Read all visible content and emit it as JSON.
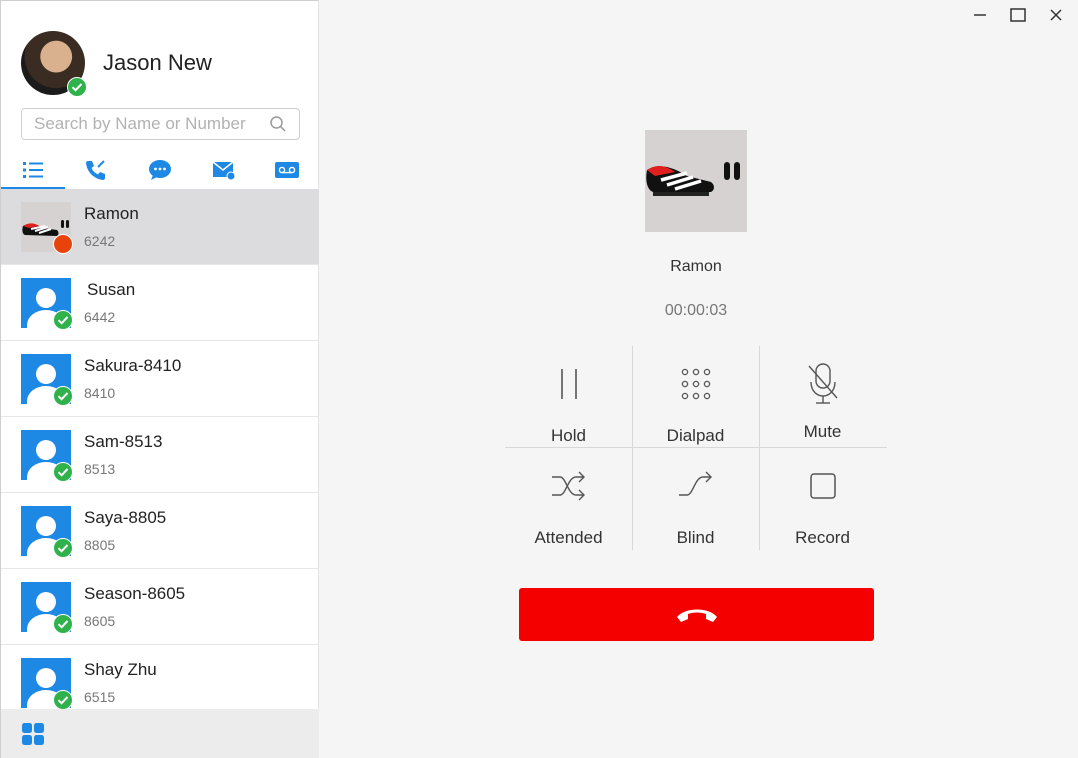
{
  "user": {
    "name": "Jason New",
    "status": "online"
  },
  "search": {
    "placeholder": "Search by Name or Number"
  },
  "tabs": [
    {
      "id": "contacts",
      "icon": "list-icon",
      "active": true
    },
    {
      "id": "calls",
      "icon": "phone-icon",
      "active": false
    },
    {
      "id": "chat",
      "icon": "chat-icon",
      "active": false
    },
    {
      "id": "voicemail-mail",
      "icon": "mail-icon",
      "active": false
    },
    {
      "id": "voicemail",
      "icon": "voicemail-icon",
      "active": false
    }
  ],
  "contacts": [
    {
      "name": "Ramon",
      "ext": "6242",
      "status": "busy",
      "avatar": "shoe"
    },
    {
      "name": "Susan",
      "ext": "6442",
      "status": "online",
      "avatar": "default"
    },
    {
      "name": "Sakura-8410",
      "ext": "8410",
      "status": "online",
      "avatar": "default"
    },
    {
      "name": "Sam-8513",
      "ext": "8513",
      "status": "online",
      "avatar": "default"
    },
    {
      "name": "Saya-8805",
      "ext": "8805",
      "status": "online",
      "avatar": "default"
    },
    {
      "name": "Season-8605",
      "ext": "8605",
      "status": "online",
      "avatar": "default"
    },
    {
      "name": "Shay Zhu",
      "ext": "6515",
      "status": "online",
      "avatar": "default"
    }
  ],
  "call": {
    "caller_name": "Ramon",
    "duration": "00:00:03",
    "actions": {
      "hold": "Hold",
      "dialpad": "Dialpad",
      "mute": "Mute",
      "attended": "Attended",
      "blind": "Blind",
      "record": "Record"
    }
  },
  "colors": {
    "accent": "#1e88e5",
    "online": "#2fb24c",
    "busy": "#e8430a",
    "hangup": "#f40000"
  }
}
